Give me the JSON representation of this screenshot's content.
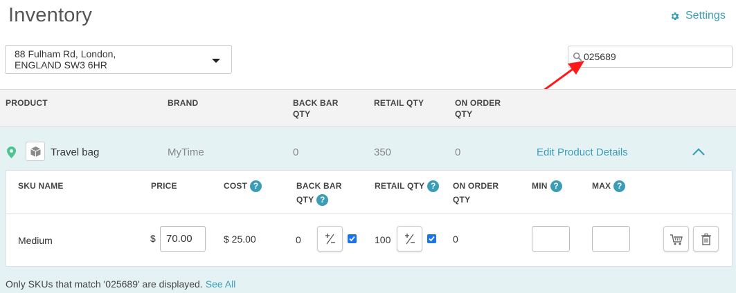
{
  "page": {
    "title": "Inventory"
  },
  "settings": {
    "label": "Settings",
    "icon": "gear-icon",
    "color": "#3a9db5"
  },
  "location": {
    "selected": "88 Fulham Rd, London,\nENGLAND SW3 6HR",
    "icon": "chevron-down-icon"
  },
  "search": {
    "value": "025689",
    "icon": "search-icon"
  },
  "table": {
    "headers": {
      "product": "PRODUCT",
      "brand": "BRAND",
      "back_bar_qty": "BACK BAR\nQTY",
      "retail_qty": "RETAIL QTY",
      "on_order_qty": "ON ORDER\nQTY"
    }
  },
  "product": {
    "name": "Travel bag",
    "brand": "MyTime",
    "back_bar_qty": "0",
    "retail_qty": "350",
    "on_order_qty": "0",
    "edit_link": "Edit Product Details",
    "icons": [
      "location-pin-icon",
      "box-icon",
      "chevron-up-icon"
    ]
  },
  "sku_table": {
    "headers": {
      "sku_name": "SKU NAME",
      "price": "PRICE",
      "cost": "COST",
      "back_bar_qty": "BACK BAR\nQTY",
      "retail_qty": "RETAIL QTY",
      "on_order_qty": "ON ORDER\nQTY",
      "min": "MIN",
      "max": "MAX"
    },
    "help_glyph": "?",
    "rows": [
      {
        "sku_name": "Medium",
        "currency": "$",
        "price": "70.00",
        "cost": "$ 25.00",
        "back_bar_qty": "0",
        "back_bar_checked": true,
        "retail_qty": "100",
        "retail_checked": true,
        "on_order_qty": "0",
        "min": "",
        "max": ""
      }
    ]
  },
  "filter_note": {
    "text": "Only SKUs that match '025689' are displayed.",
    "link": "See All"
  },
  "colors": {
    "accent": "#3a9db5",
    "product_bg": "#e5f2f4",
    "annotation_arrow": "#ff1a1a",
    "checkbox": "#1a73e8"
  }
}
